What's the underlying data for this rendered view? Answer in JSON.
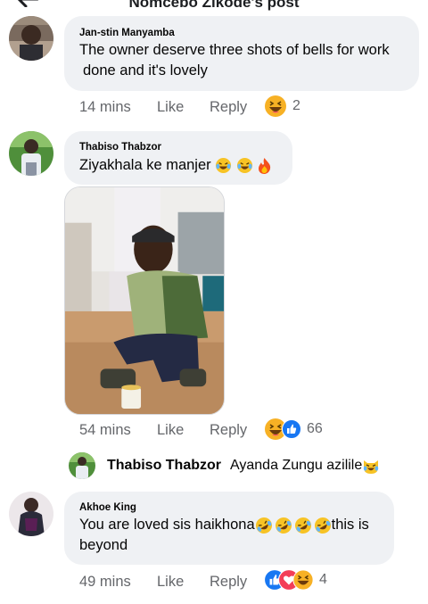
{
  "header": {
    "title": "Nomcebo Zikode's post"
  },
  "comments": [
    {
      "author": "Jan-stin Manyamba",
      "lines": [
        "The owner deserve three shots of bells for work",
        "done and it's lovely"
      ],
      "time": "14 mins",
      "like_label": "Like",
      "reply_label": "Reply",
      "reaction_icons": [
        "haha-reaction-icon"
      ],
      "reaction_count": "2"
    },
    {
      "author": "Thabiso Thabzor",
      "lines": [
        "Ziyakhala ke manjer"
      ],
      "text_emojis": [
        "tears-of-joy-emoji",
        "tears-of-joy-emoji",
        "fire-emoji"
      ],
      "time": "54 mins",
      "like_label": "Like",
      "reply_label": "Reply",
      "reaction_icons": [
        "haha-reaction-icon",
        "like-reaction-icon"
      ],
      "reaction_count": "66"
    },
    {
      "author": "Akhoe King",
      "lines": [
        "You are loved sis haikhona",
        "beyond"
      ],
      "line1_suffix": "this is",
      "text_emojis": [
        "rofl-emoji",
        "rofl-emoji",
        "rofl-emoji",
        "rofl-emoji"
      ],
      "time": "49 mins",
      "like_label": "Like",
      "reply_label": "Reply",
      "reaction_icons": [
        "like-reaction-icon",
        "love-reaction-icon",
        "haha-reaction-icon"
      ],
      "reaction_count": "4"
    }
  ],
  "reply_preview": {
    "author": "Thabiso Thabzor",
    "text": "Ayanda Zungu azilile",
    "emoji": "crying-laughing-cat-emoji"
  },
  "colors": {
    "bubble": "#eff1f4",
    "meta_text": "#65676b",
    "like_blue": "#1877f2",
    "love_red": "#f33e58",
    "haha_yellow": "#f7b125"
  }
}
